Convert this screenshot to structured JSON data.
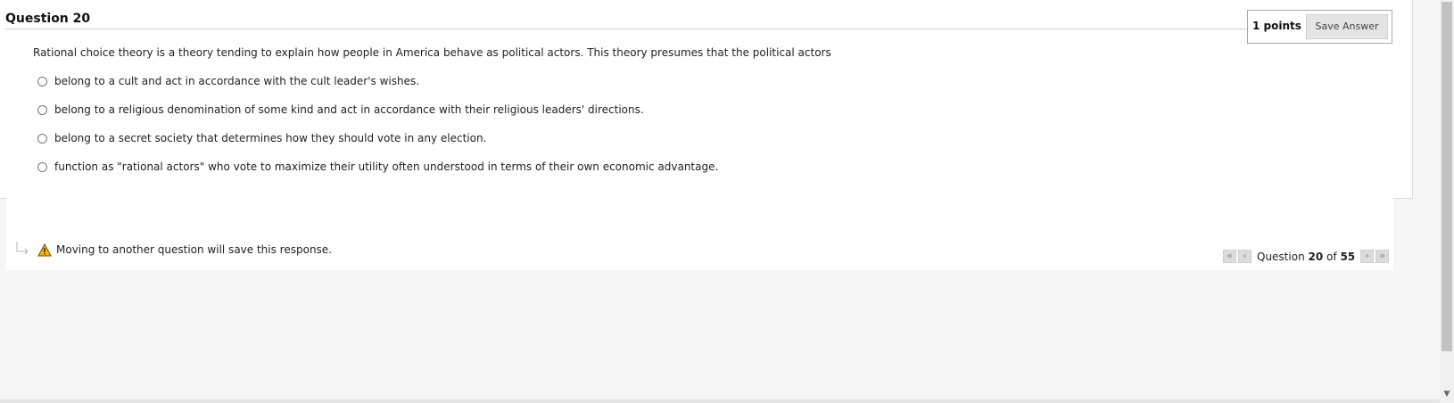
{
  "question": {
    "title": "Question 20",
    "points": "1 points",
    "save_label": "Save Answer",
    "prompt": "Rational choice theory is a theory tending to explain how people in America behave as political actors.  This theory presumes that the political actors",
    "options": [
      {
        "label": "belong to a cult and act in accordance with the cult leader's wishes."
      },
      {
        "label": "belong to a religious denomination of some kind and act in accordance with their religious leaders' directions."
      },
      {
        "label": "belong to a secret society that determines how they should vote in any election."
      },
      {
        "label": "function as \"rational actors\" who vote to maximize their utility often understood in terms of their own economic advantage."
      }
    ]
  },
  "notice": {
    "text": "Moving to another question will save this response."
  },
  "pager": {
    "prefix": "Question",
    "current": "20",
    "of": "of",
    "total": "55",
    "first_icon": "«",
    "prev_icon": "‹",
    "next_icon": "›",
    "last_icon": "»"
  },
  "colors": {
    "accent_warning": "#f0a400"
  }
}
